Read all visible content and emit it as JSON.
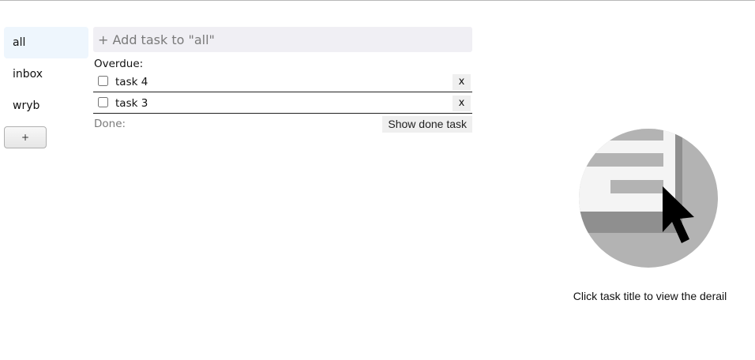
{
  "sidebar": {
    "lists": [
      {
        "label": "all",
        "active": true
      },
      {
        "label": "inbox",
        "active": false
      },
      {
        "label": "wryb",
        "active": false
      }
    ],
    "add_list_label": "+"
  },
  "main": {
    "add_task_placeholder": "+ Add task to \"all\"",
    "overdue_label": "Overdue:",
    "tasks": [
      {
        "title": "task 4",
        "checked": false,
        "delete_label": "x"
      },
      {
        "title": "task 3",
        "checked": false,
        "delete_label": "x"
      }
    ],
    "done_label": "Done:",
    "show_done_label": "Show done task"
  },
  "detail": {
    "illustration": "cursor-click-illustration",
    "hint": "Click task title to view the derail"
  },
  "colors": {
    "active_list_bg": "#eef6fd",
    "input_bg": "#f0eff4",
    "muted_text": "#7a7a7a"
  }
}
